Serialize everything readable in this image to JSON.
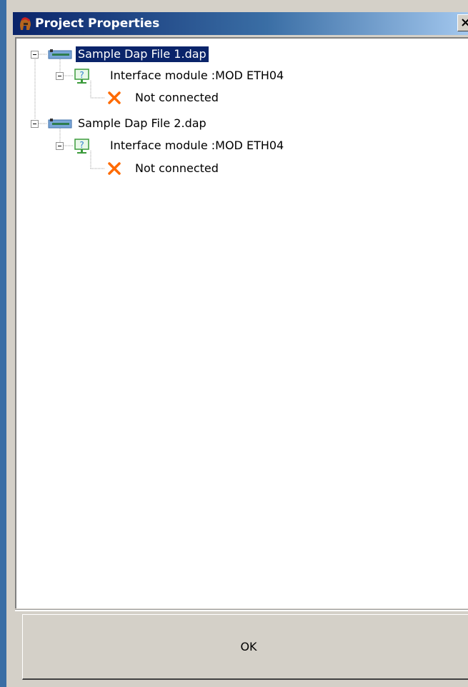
{
  "window": {
    "title": "Project Properties",
    "titlebar_gradient": [
      "#0a246a",
      "#3a6ea5",
      "#a6caf0"
    ],
    "icons": {
      "app": "spartan-helmet-icon",
      "close": "close-x-icon"
    }
  },
  "tree": {
    "nodes": [
      {
        "label": "Sample Dap File 1.dap",
        "icon": "device-icon",
        "selected": true
      },
      {
        "label": "Interface module :MOD ETH04",
        "icon": "interface-module-icon",
        "selected": false
      },
      {
        "label": "Not connected",
        "icon": "disconnected-x-icon",
        "selected": false
      },
      {
        "label": "Sample Dap File 2.dap",
        "icon": "device-icon",
        "selected": false
      },
      {
        "label": "Interface module :MOD ETH04",
        "icon": "interface-module-icon",
        "selected": false
      },
      {
        "label": "Not connected",
        "icon": "disconnected-x-icon",
        "selected": false
      }
    ],
    "selection_color": "#0a246a"
  },
  "footer": {
    "ok_label": "OK"
  }
}
